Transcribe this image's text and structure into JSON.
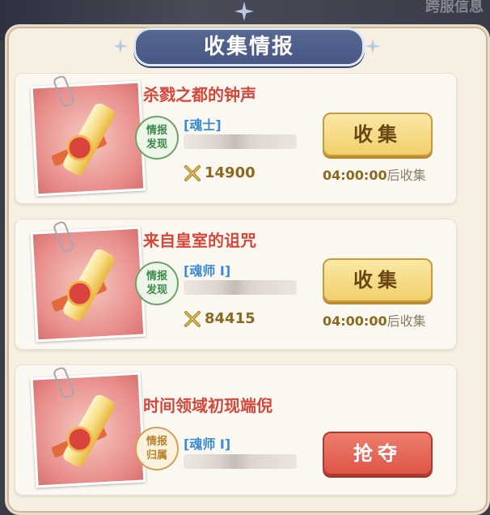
{
  "header": {
    "title": "收集情报",
    "corner_text": "跨服信息"
  },
  "cards": [
    {
      "title": "杀戮之都的钟声",
      "stamp": "情报发现",
      "rank": "[魂士]",
      "power": "14900",
      "button": "收集",
      "timer": "04:00:00",
      "timer_suffix": "后收集"
    },
    {
      "title": "来自皇室的诅咒",
      "stamp": "情报发现",
      "rank": "[魂师 I]",
      "power": "84415",
      "button": "收集",
      "timer": "04:00:00",
      "timer_suffix": "后收集"
    },
    {
      "title": "时间领域初现端倪",
      "stamp": "情报归属",
      "rank": "[魂师 I]",
      "button": "抢夺"
    }
  ],
  "colors": {
    "accent_red": "#d5473a",
    "rank_blue": "#3a8bd4",
    "collect_gold": "#f1cf6b",
    "rob_red": "#de5547"
  }
}
